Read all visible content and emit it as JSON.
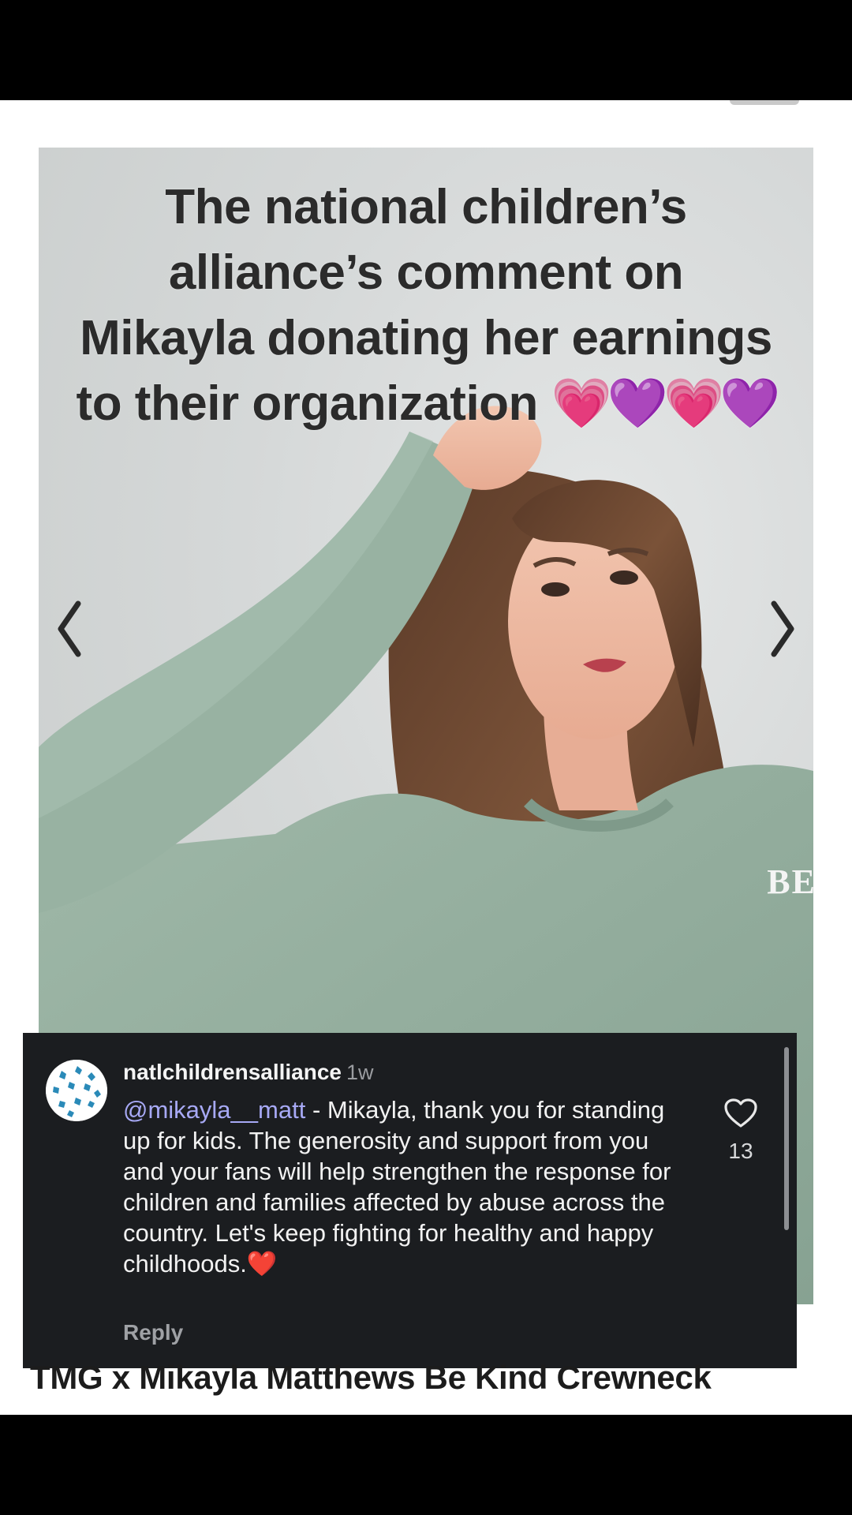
{
  "post": {
    "title_lines": [
      "The national children’s",
      "alliance’s comment on",
      "Mikayla donating her earnings",
      "to their organization"
    ],
    "hearts": "💗💜💗💜"
  },
  "product": {
    "image_text": "BE",
    "name": "TMG x Mikayla Matthews Be Kind Crewneck",
    "nav_prev": "‹",
    "nav_next": "›"
  },
  "comment": {
    "username": "natlchildrensalliance",
    "time": "1w",
    "mention": "@mikayla__matt",
    "text": " - Mikayla, thank you for standing up for kids. The generosity and support from you and your fans will help strengthen the response for children and families affected by abuse across the country. Let's keep fighting for healthy and happy childhoods.",
    "emoji": "❤️",
    "like_count": "13",
    "reply_label": "Reply"
  },
  "colors": {
    "comment_bg": "#1b1d20",
    "mention": "#a7a9f5",
    "sweater": "#94ad9e"
  },
  "carousel": {
    "dot_count": 8,
    "active_index": 1
  }
}
